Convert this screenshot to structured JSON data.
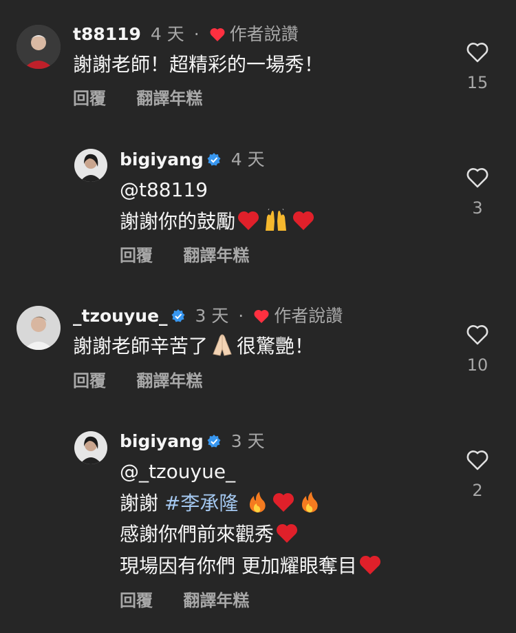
{
  "comments": [
    {
      "username": "t88119",
      "time": "4 天",
      "dot": "·",
      "liked_label": "作者說讚",
      "lines": [
        "謝謝老師！超精彩的一場秀！"
      ],
      "reply_label": "回覆",
      "translate_label": "翻譯年糕",
      "likes": "15"
    },
    {
      "username": "bigiyang",
      "time": "4 天",
      "mention": "@t88119",
      "line2_text": "謝謝你的鼓勵",
      "reply_label": "回覆",
      "translate_label": "翻譯年糕",
      "likes": "3"
    },
    {
      "username": "_tzouyue_",
      "time": "3 天",
      "dot": "·",
      "liked_label": "作者說讚",
      "line_pre": "謝謝老師辛苦了",
      "line_post": "很驚艷！",
      "reply_label": "回覆",
      "translate_label": "翻譯年糕",
      "likes": "10"
    },
    {
      "username": "bigiyang",
      "time": "3 天",
      "mention": "@_tzouyue_",
      "line2_pre": "謝謝 ",
      "hashtag": "#李承隆",
      "line3": "感謝你們前來觀秀",
      "line4": "現場因有你們 更加耀眼奪目",
      "reply_label": "回覆",
      "translate_label": "翻譯年糕",
      "likes": "2"
    }
  ],
  "colors": {
    "background": "#262626",
    "verified": "#3897f0",
    "heart_red": "#ff3040",
    "secondary_text": "#a8a8a8",
    "hashtag": "#a4c8f0"
  }
}
